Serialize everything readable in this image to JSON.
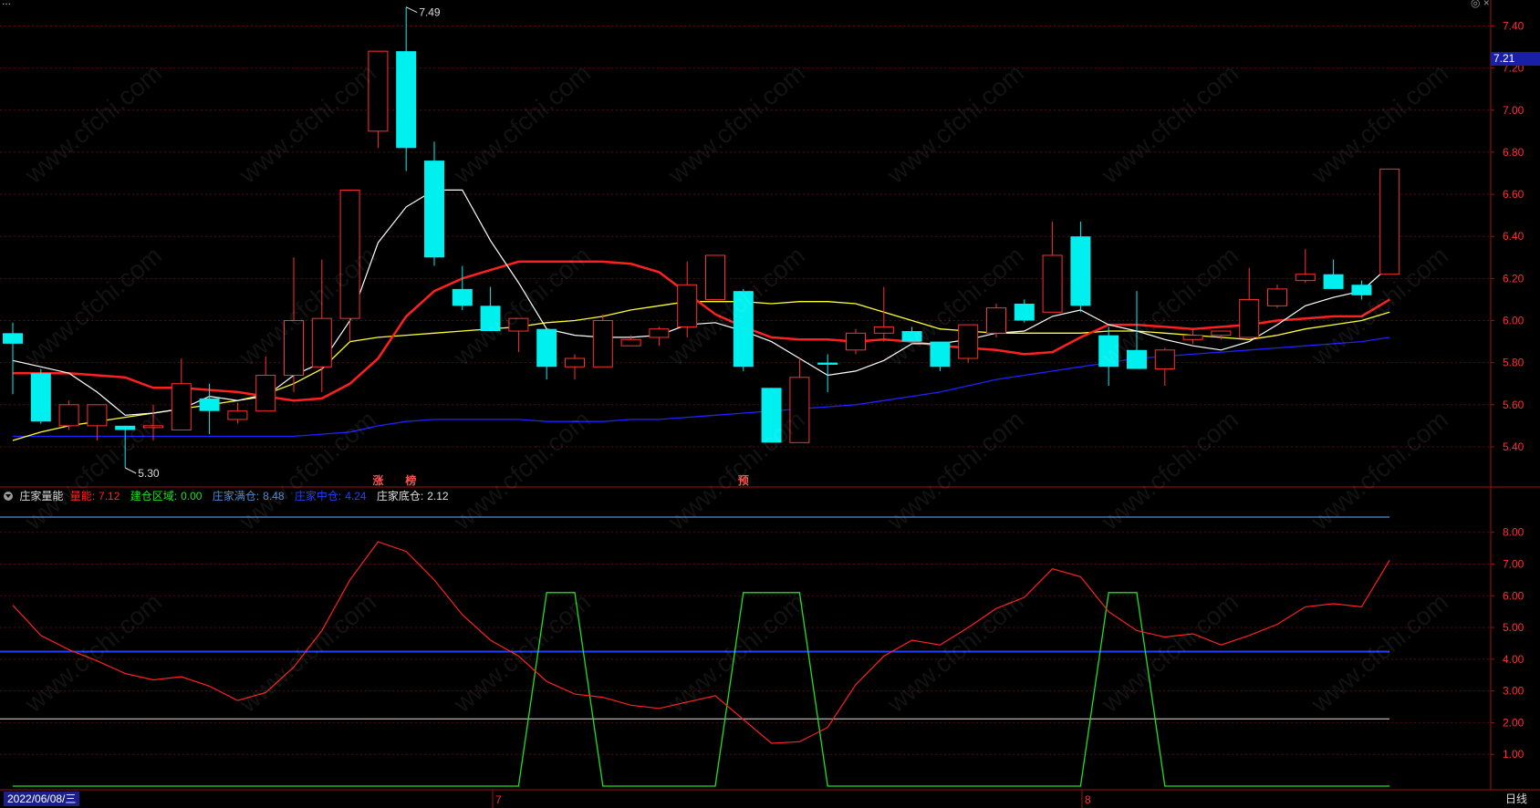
{
  "header": {
    "title": "庄家量能",
    "values": [
      {
        "label": "量能:",
        "value": "7.12",
        "color": "#ff2020"
      },
      {
        "label": "建仓区域:",
        "value": "0.00",
        "color": "#20e020"
      },
      {
        "label": "庄家满仓:",
        "value": "8.48",
        "color": "#4f8fcf"
      },
      {
        "label": "庄家中仓:",
        "value": "4.24",
        "color": "#2040ff"
      },
      {
        "label": "庄家底仓:",
        "value": "2.12",
        "color": "#e0e0e0"
      }
    ]
  },
  "footer": {
    "date": "2022/06/08/三",
    "period": "日线",
    "month_marks": [
      "7",
      "8"
    ]
  },
  "price_axis": {
    "current_price": "7.21",
    "ticks": [
      "7.40",
      "7.20",
      "7.00",
      "6.80",
      "6.60",
      "6.40",
      "6.20",
      "6.00",
      "5.80",
      "5.60",
      "5.40"
    ]
  },
  "indicator_axis": {
    "ticks": [
      "8.00",
      "7.00",
      "6.00",
      "5.00",
      "4.00",
      "3.00",
      "2.00",
      "1.00"
    ]
  },
  "annotations": {
    "high_label": "7.49",
    "low_label": "5.30",
    "markers": [
      "涨",
      "榜",
      "预"
    ]
  },
  "watermark": "www.cfchi.com",
  "colors": {
    "up": "#ff3030",
    "down": "#00f0f0",
    "ma5": "#ffffff",
    "ma10": "#ffff30",
    "ma20": "#ff2020",
    "ma60": "#2020ff",
    "volume_line": "#ff2020",
    "build_zone": "#20e020",
    "full_line": "#4f8fcf",
    "mid_line": "#2040ff",
    "base_line": "#e0e0e0"
  },
  "chart_data": [
    {
      "type": "candlestick",
      "ylim": [
        5.25,
        7.5
      ],
      "candles": [
        {
          "o": 5.94,
          "c": 5.89,
          "h": 5.99,
          "l": 5.65
        },
        {
          "o": 5.75,
          "c": 5.52,
          "h": 5.77,
          "l": 5.51
        },
        {
          "o": 5.5,
          "c": 5.6,
          "h": 5.62,
          "l": 5.48
        },
        {
          "o": 5.5,
          "c": 5.6,
          "h": 5.6,
          "l": 5.43
        },
        {
          "o": 5.5,
          "c": 5.48,
          "h": 5.5,
          "l": 5.3
        },
        {
          "o": 5.5,
          "c": 5.5,
          "h": 5.6,
          "l": 5.43
        },
        {
          "o": 5.48,
          "c": 5.7,
          "h": 5.82,
          "l": 5.48
        },
        {
          "o": 5.63,
          "c": 5.57,
          "h": 5.7,
          "l": 5.46
        },
        {
          "o": 5.53,
          "c": 5.57,
          "h": 5.61,
          "l": 5.51
        },
        {
          "o": 5.57,
          "c": 5.74,
          "h": 5.83,
          "l": 5.57
        },
        {
          "o": 5.74,
          "c": 6.0,
          "h": 6.3,
          "l": 5.66
        },
        {
          "o": 5.78,
          "c": 6.01,
          "h": 6.29,
          "l": 5.66
        },
        {
          "o": 6.01,
          "c": 6.62,
          "h": 6.62,
          "l": 5.9
        },
        {
          "o": 6.9,
          "c": 7.28,
          "h": 7.28,
          "l": 6.82
        },
        {
          "o": 7.28,
          "c": 6.82,
          "h": 7.49,
          "l": 6.71
        },
        {
          "o": 6.76,
          "c": 6.3,
          "h": 6.85,
          "l": 6.26
        },
        {
          "o": 6.15,
          "c": 6.07,
          "h": 6.26,
          "l": 6.05
        },
        {
          "o": 6.07,
          "c": 5.95,
          "h": 6.16,
          "l": 5.95
        },
        {
          "o": 5.95,
          "c": 6.01,
          "h": 6.01,
          "l": 5.85
        },
        {
          "o": 5.96,
          "c": 5.78,
          "h": 5.96,
          "l": 5.72
        },
        {
          "o": 5.78,
          "c": 5.82,
          "h": 5.84,
          "l": 5.72
        },
        {
          "o": 5.78,
          "c": 6.0,
          "h": 6.03,
          "l": 5.78
        },
        {
          "o": 5.88,
          "c": 5.91,
          "h": 5.93,
          "l": 5.88
        },
        {
          "o": 5.92,
          "c": 5.96,
          "h": 5.97,
          "l": 5.88
        },
        {
          "o": 5.97,
          "c": 6.17,
          "h": 6.28,
          "l": 5.92
        },
        {
          "o": 6.1,
          "c": 6.31,
          "h": 6.31,
          "l": 6.1
        },
        {
          "o": 6.14,
          "c": 5.78,
          "h": 6.15,
          "l": 5.76
        },
        {
          "o": 5.68,
          "c": 5.42,
          "h": 5.68,
          "l": 5.42
        },
        {
          "o": 5.42,
          "c": 5.73,
          "h": 5.82,
          "l": 5.42
        },
        {
          "o": 5.8,
          "c": 5.79,
          "h": 5.84,
          "l": 5.66
        },
        {
          "o": 5.86,
          "c": 5.94,
          "h": 5.96,
          "l": 5.84
        },
        {
          "o": 5.94,
          "c": 5.97,
          "h": 6.16,
          "l": 5.9
        },
        {
          "o": 5.95,
          "c": 5.9,
          "h": 5.97,
          "l": 5.9
        },
        {
          "o": 5.9,
          "c": 5.78,
          "h": 5.9,
          "l": 5.76
        },
        {
          "o": 5.82,
          "c": 5.98,
          "h": 5.98,
          "l": 5.8
        },
        {
          "o": 5.94,
          "c": 6.06,
          "h": 6.08,
          "l": 5.92
        },
        {
          "o": 6.08,
          "c": 6.0,
          "h": 6.1,
          "l": 5.99
        },
        {
          "o": 6.04,
          "c": 6.31,
          "h": 6.47,
          "l": 6.04
        },
        {
          "o": 6.4,
          "c": 6.07,
          "h": 6.47,
          "l": 6.04
        },
        {
          "o": 5.93,
          "c": 5.78,
          "h": 5.97,
          "l": 5.69
        },
        {
          "o": 5.86,
          "c": 5.77,
          "h": 6.14,
          "l": 5.77
        },
        {
          "o": 5.77,
          "c": 5.86,
          "h": 5.87,
          "l": 5.69
        },
        {
          "o": 5.91,
          "c": 5.93,
          "h": 5.96,
          "l": 5.89
        },
        {
          "o": 5.93,
          "c": 5.95,
          "h": 5.95,
          "l": 5.91
        },
        {
          "o": 5.92,
          "c": 6.1,
          "h": 6.25,
          "l": 5.92
        },
        {
          "o": 6.07,
          "c": 6.15,
          "h": 6.17,
          "l": 6.06
        },
        {
          "o": 6.19,
          "c": 6.22,
          "h": 6.34,
          "l": 6.18
        },
        {
          "o": 6.22,
          "c": 6.15,
          "h": 6.29,
          "l": 6.15
        },
        {
          "o": 6.17,
          "c": 6.12,
          "h": 6.19,
          "l": 6.1
        },
        {
          "o": 6.22,
          "c": 6.72,
          "h": 6.72,
          "l": 6.22
        }
      ],
      "ma5": [
        5.81,
        5.78,
        5.75,
        5.66,
        5.55,
        5.56,
        5.58,
        5.64,
        5.62,
        5.64,
        5.74,
        5.8,
        6.0,
        6.37,
        6.54,
        6.62,
        6.62,
        6.38,
        6.18,
        5.96,
        5.93,
        5.92,
        5.92,
        5.93,
        5.98,
        5.99,
        5.95,
        5.9,
        5.82,
        5.74,
        5.76,
        5.81,
        5.89,
        5.89,
        5.91,
        5.94,
        5.95,
        6.02,
        6.05,
        5.98,
        5.95,
        5.91,
        5.88,
        5.86,
        5.9,
        5.98,
        6.07,
        6.11,
        6.14,
        6.26
      ],
      "ma10": [
        5.43,
        5.47,
        5.5,
        5.52,
        5.54,
        5.56,
        5.58,
        5.6,
        5.62,
        5.65,
        5.7,
        5.77,
        5.9,
        5.92,
        5.93,
        5.94,
        5.95,
        5.96,
        5.97,
        5.99,
        6.0,
        6.02,
        6.05,
        6.07,
        6.09,
        6.09,
        6.09,
        6.08,
        6.09,
        6.09,
        6.08,
        6.04,
        6.0,
        5.96,
        5.95,
        5.94,
        5.94,
        5.94,
        5.94,
        5.95,
        5.95,
        5.94,
        5.93,
        5.92,
        5.91,
        5.93,
        5.96,
        5.98,
        6.0,
        6.04
      ],
      "ma20": [
        5.75,
        5.75,
        5.75,
        5.74,
        5.73,
        5.68,
        5.68,
        5.67,
        5.66,
        5.64,
        5.62,
        5.63,
        5.7,
        5.82,
        6.02,
        6.14,
        6.2,
        6.24,
        6.28,
        6.28,
        6.28,
        6.28,
        6.27,
        6.23,
        6.13,
        6.03,
        5.97,
        5.92,
        5.91,
        5.91,
        5.9,
        5.91,
        5.9,
        5.88,
        5.87,
        5.86,
        5.84,
        5.85,
        5.92,
        5.98,
        5.98,
        5.97,
        5.96,
        5.97,
        5.98,
        6.0,
        6.01,
        6.02,
        6.02,
        6.1
      ],
      "ma60": [
        5.45,
        5.45,
        5.45,
        5.45,
        5.45,
        5.45,
        5.45,
        5.45,
        5.45,
        5.45,
        5.45,
        5.46,
        5.47,
        5.5,
        5.52,
        5.53,
        5.53,
        5.53,
        5.53,
        5.52,
        5.52,
        5.52,
        5.53,
        5.53,
        5.54,
        5.55,
        5.56,
        5.57,
        5.58,
        5.59,
        5.6,
        5.62,
        5.64,
        5.66,
        5.69,
        5.72,
        5.74,
        5.76,
        5.78,
        5.8,
        5.82,
        5.83,
        5.84,
        5.85,
        5.86,
        5.87,
        5.88,
        5.89,
        5.9,
        5.92
      ]
    },
    {
      "type": "line",
      "ylim": [
        0.5,
        9.0
      ],
      "series": [
        {
          "name": "量能",
          "values": [
            5.7,
            4.75,
            4.3,
            3.95,
            3.55,
            3.35,
            3.45,
            3.15,
            2.7,
            2.95,
            3.75,
            4.9,
            6.5,
            7.7,
            7.4,
            6.5,
            5.4,
            4.6,
            4.1,
            3.3,
            2.9,
            2.8,
            2.55,
            2.45,
            2.65,
            2.85,
            2.1,
            1.35,
            1.4,
            1.85,
            3.2,
            4.1,
            4.6,
            4.45,
            5.0,
            5.6,
            5.95,
            6.85,
            6.6,
            5.5,
            4.9,
            4.7,
            4.8,
            4.45,
            4.75,
            5.1,
            5.65,
            5.75,
            5.65,
            7.12
          ]
        },
        {
          "name": "建仓区域",
          "values": [
            0,
            0,
            0,
            0,
            0,
            0,
            0,
            0,
            0,
            0,
            0,
            0,
            0,
            0,
            0,
            0,
            0,
            0,
            0,
            6.1,
            6.1,
            0,
            0,
            0,
            0,
            0,
            6.1,
            6.1,
            6.1,
            0,
            0,
            0,
            0,
            0,
            0,
            0,
            0,
            0,
            0,
            6.1,
            6.1,
            0,
            0,
            0,
            0,
            0,
            0,
            0,
            0,
            0
          ]
        },
        {
          "name": "庄家满仓",
          "values": [
            8.48
          ]
        },
        {
          "name": "庄家中仓",
          "values": [
            4.24
          ]
        },
        {
          "name": "庄家底仓",
          "values": [
            2.12
          ]
        }
      ]
    }
  ]
}
